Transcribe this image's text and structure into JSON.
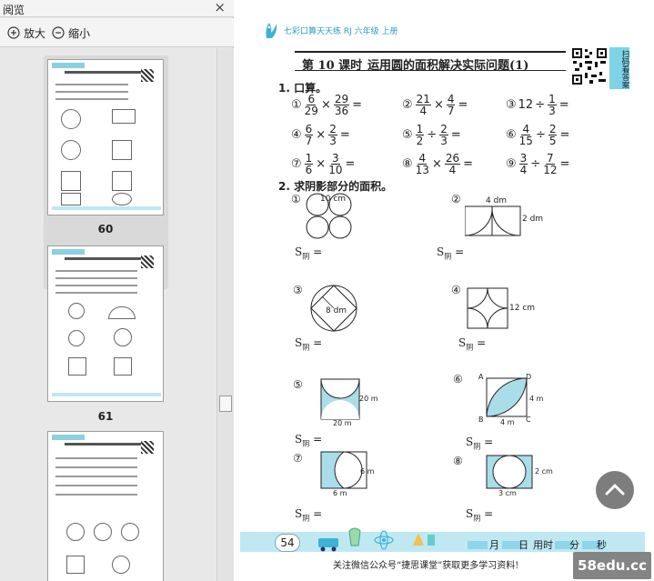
{
  "sidebar": {
    "title": "阅览",
    "zoom_in": "放大",
    "zoom_out": "缩小",
    "thumbnails": [
      {
        "label": "60"
      },
      {
        "label": "61"
      },
      {
        "label": ""
      }
    ]
  },
  "document": {
    "header": "七彩口算天天练  RJ  六年级  上册",
    "lesson": "第 10 课时",
    "lesson_title": "运用圆的面积解决实际问题(1)",
    "scan_text": "扫码看答案",
    "section1": "1. 口算。",
    "section2": "2. 求阴影部分的面积。",
    "calc": [
      {
        "n": "①",
        "a": [
          "6",
          "29"
        ],
        "op": "×",
        "b": [
          "29",
          "36"
        ]
      },
      {
        "n": "②",
        "a": [
          "21",
          "4"
        ],
        "op": "×",
        "b": [
          "4",
          "7"
        ]
      },
      {
        "n": "③",
        "a": "12",
        "op": "÷",
        "b": [
          "1",
          "3"
        ]
      },
      {
        "n": "④",
        "a": [
          "6",
          "7"
        ],
        "op": "×",
        "b": [
          "2",
          "3"
        ]
      },
      {
        "n": "⑤",
        "a": [
          "1",
          "2"
        ],
        "op": "÷",
        "b": [
          "2",
          "3"
        ]
      },
      {
        "n": "⑥",
        "a": [
          "4",
          "15"
        ],
        "op": "÷",
        "b": [
          "2",
          "5"
        ]
      },
      {
        "n": "⑦",
        "a": [
          "1",
          "6"
        ],
        "op": "×",
        "b": [
          "3",
          "10"
        ]
      },
      {
        "n": "⑧",
        "a": [
          "4",
          "13"
        ],
        "op": "×",
        "b": [
          "26",
          "4"
        ]
      },
      {
        "n": "⑨",
        "a": [
          "3",
          "4"
        ],
        "op": "÷",
        "b": [
          "7",
          "12"
        ]
      }
    ],
    "equals": "=",
    "fig_nums": [
      "①",
      "②",
      "③",
      "④",
      "⑤",
      "⑥",
      "⑦",
      "⑧"
    ],
    "fig_dims": {
      "f1": "10 cm",
      "f2_w": "4 dm",
      "f2_h": "2 dm",
      "f3": "8 dm",
      "f4": "12 cm",
      "f5_h": "20 m",
      "f5_w": "20 m",
      "f6_h": "4 m",
      "f6_w": "4 m",
      "f6_a": "A",
      "f6_b": "B",
      "f6_c": "C",
      "f6_d": "D",
      "f7_h": "6 m",
      "f7_w": "6 m",
      "f8_h": "2 cm",
      "f8_w": "3 cm"
    },
    "s_label": "S",
    "s_sub": "阴",
    "page_number": "54",
    "footer_labels": [
      "月",
      "日",
      "用时",
      "分",
      "秒"
    ],
    "promo": "关注微信公众号“捷思课堂”获取更多学习资料!",
    "watermark": "58edu.cc"
  },
  "colors": {
    "accent": "#2a9cc4",
    "band": "#bfe8f3",
    "shade": "#a9dde9"
  }
}
